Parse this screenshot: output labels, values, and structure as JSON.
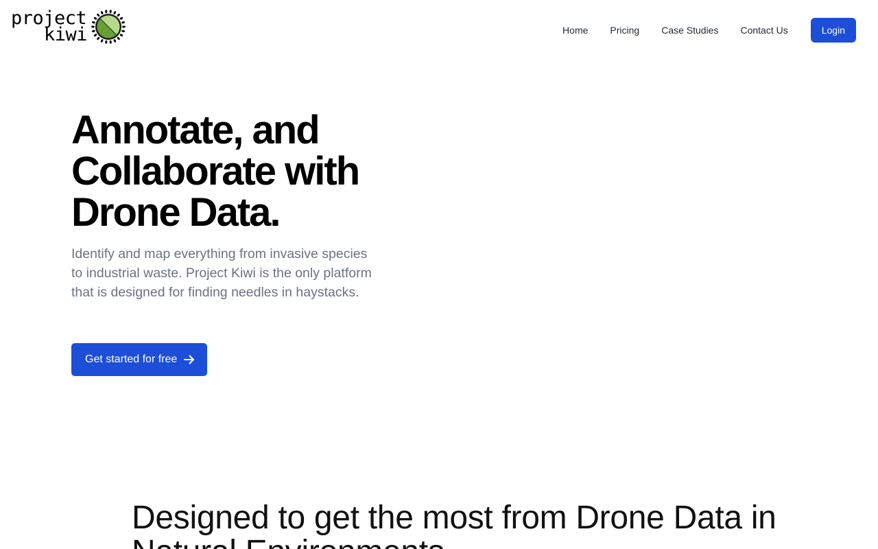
{
  "header": {
    "logo": {
      "line1": "project",
      "line2": "kiwi",
      "icon": "kiwi-fruit-icon"
    },
    "nav": [
      {
        "label": "Home"
      },
      {
        "label": "Pricing"
      },
      {
        "label": "Case Studies"
      },
      {
        "label": "Contact Us"
      }
    ],
    "login_label": "Login"
  },
  "hero": {
    "title": "Annotate, and Collaborate with Drone Data.",
    "subtitle": "Identify and map everything from invasive species to industrial waste. Project Kiwi is the only platform that is designed for finding needles in haystacks.",
    "cta_label": "Get started for free",
    "cta_icon": "arrow-right-icon"
  },
  "features": {
    "title": "Designed to get the most from Drone Data in Natural Environments"
  },
  "colors": {
    "accent": "#1d4ed8",
    "kiwi_light": "#b7d98b",
    "kiwi_dark": "#6a9f35",
    "subtitle_text": "#6b7280"
  }
}
